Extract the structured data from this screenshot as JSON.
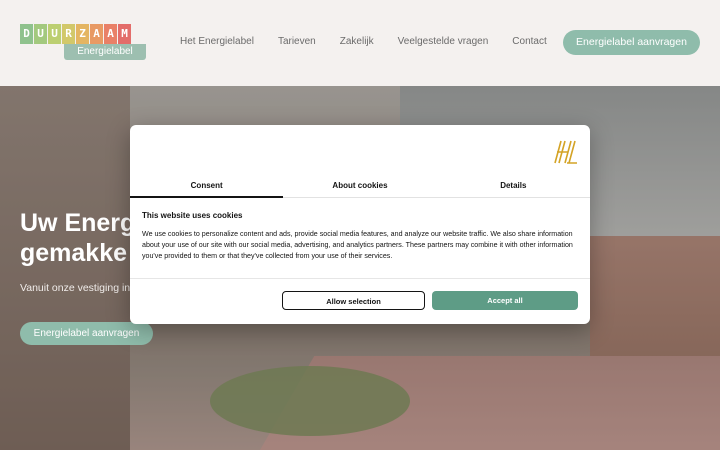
{
  "logo": {
    "letters": [
      "D",
      "U",
      "U",
      "R",
      "Z",
      "A",
      "A",
      "M"
    ],
    "letter_colors": [
      "#8fc28d",
      "#a3c97e",
      "#bccf71",
      "#d2c86a",
      "#e4b562",
      "#e89a64",
      "#e98067",
      "#e36d6a"
    ],
    "subtitle": "Energielabel"
  },
  "nav": {
    "items": [
      "Het Energielabel",
      "Tarieven",
      "Zakelijk",
      "Veelgestelde vragen",
      "Contact"
    ],
    "cta": "Energielabel aanvragen"
  },
  "hero": {
    "title_line1": "Uw Energ",
    "title_line2": "gemakke",
    "text": "Vanuit onze vestiging in ... het verkrijgen van een n...",
    "cta": "Energielabel aanvragen"
  },
  "cookie": {
    "tabs": [
      "Consent",
      "About cookies",
      "Details"
    ],
    "active_tab": "Consent",
    "title": "This website uses cookies",
    "body": "We use cookies to personalize content and ads, provide social media features, and analyze our website traffic. We also share information about your use of our site with our social media, advertising, and analytics partners. These partners may combine it with other information you've provided to them or that they've collected from your use of their services.",
    "allow_selection": "Allow selection",
    "accept_all": "Accept all",
    "brand_icon": "hl-logo-icon"
  },
  "colors": {
    "accent": "#8fbcab",
    "accept": "#5e9c86"
  }
}
